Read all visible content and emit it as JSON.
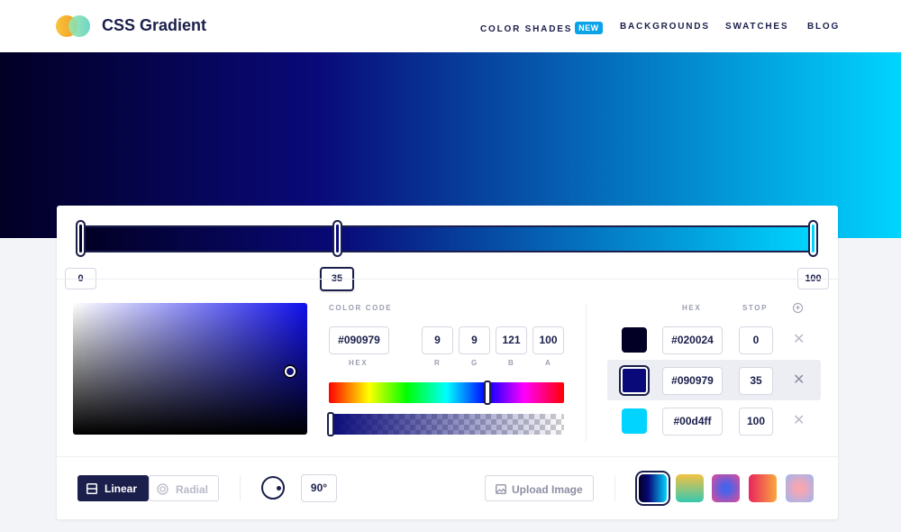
{
  "header": {
    "brand": "CSS Gradient",
    "nav": [
      {
        "label": "COLOR SHADES",
        "badge": "NEW"
      },
      {
        "label": "BACKGROUNDS"
      },
      {
        "label": "SWATCHES"
      },
      {
        "label": "BLOG"
      }
    ]
  },
  "colors": {
    "stop1": "#020024",
    "stop2": "#090979",
    "stop3": "#00d4ff",
    "accent": "#1b1f4b",
    "badge": "#0aa3e8"
  },
  "gradient_bar": {
    "stop_positions": [
      "0",
      "35",
      "100"
    ],
    "active_stop": 1
  },
  "color_code": {
    "label": "COLOR CODE",
    "hex_value": "#090979",
    "r": "9",
    "g": "9",
    "b": "121",
    "a": "100",
    "hex_label": "HEX",
    "r_label": "R",
    "g_label": "G",
    "b_label": "B",
    "a_label": "A",
    "hue_value": 0.67,
    "alpha_value": 1.0
  },
  "stops_table": {
    "hex_header": "HEX",
    "stop_header": "STOP",
    "add_icon": "plus-circle-icon",
    "rows": [
      {
        "hex": "#020024",
        "stop": "0"
      },
      {
        "hex": "#090979",
        "stop": "35"
      },
      {
        "hex": "#00d4ff",
        "stop": "100"
      }
    ],
    "remove_icon": "close-icon"
  },
  "controls": {
    "linear_label": "Linear",
    "radial_label": "Radial",
    "angle_value": "90°",
    "upload_label": "Upload Image"
  },
  "presets": [
    "dark-blue-cyan",
    "yellow-teal",
    "blue-pink",
    "red-orange",
    "pink-purple"
  ]
}
